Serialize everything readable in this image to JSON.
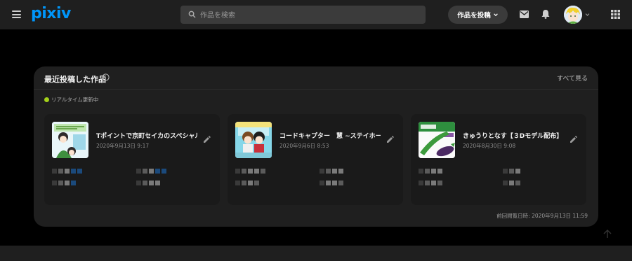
{
  "header": {
    "logo_text": "pixiv",
    "search_placeholder": "作品を検索",
    "post_button_label": "作品を投稿",
    "icons": [
      "menu-icon",
      "search-icon",
      "chevron-down-icon",
      "mail-icon",
      "bell-icon",
      "chevron-down-icon",
      "apps-grid-icon"
    ],
    "accent_color": "#0096fa"
  },
  "panel": {
    "title": "最近投稿した作品",
    "see_all_label": "すべて見る",
    "realtime_label": "リアルタイム更新中",
    "realtime_dot_color": "#a4d11a",
    "last_viewed": "前回閲覧日時: 2020年9月13日 11:59",
    "works": [
      {
        "title": "Tポイントで京町セイカのスペシャル...",
        "date": "2020年9月13日 9:17"
      },
      {
        "title": "コードキャプター　慧 ~ステイホーム編~",
        "date": "2020年9月6日 8:53"
      },
      {
        "title": "きゅうりとなす【３Dモデル配布】",
        "date": "2020年8月30日 9:08"
      }
    ]
  }
}
